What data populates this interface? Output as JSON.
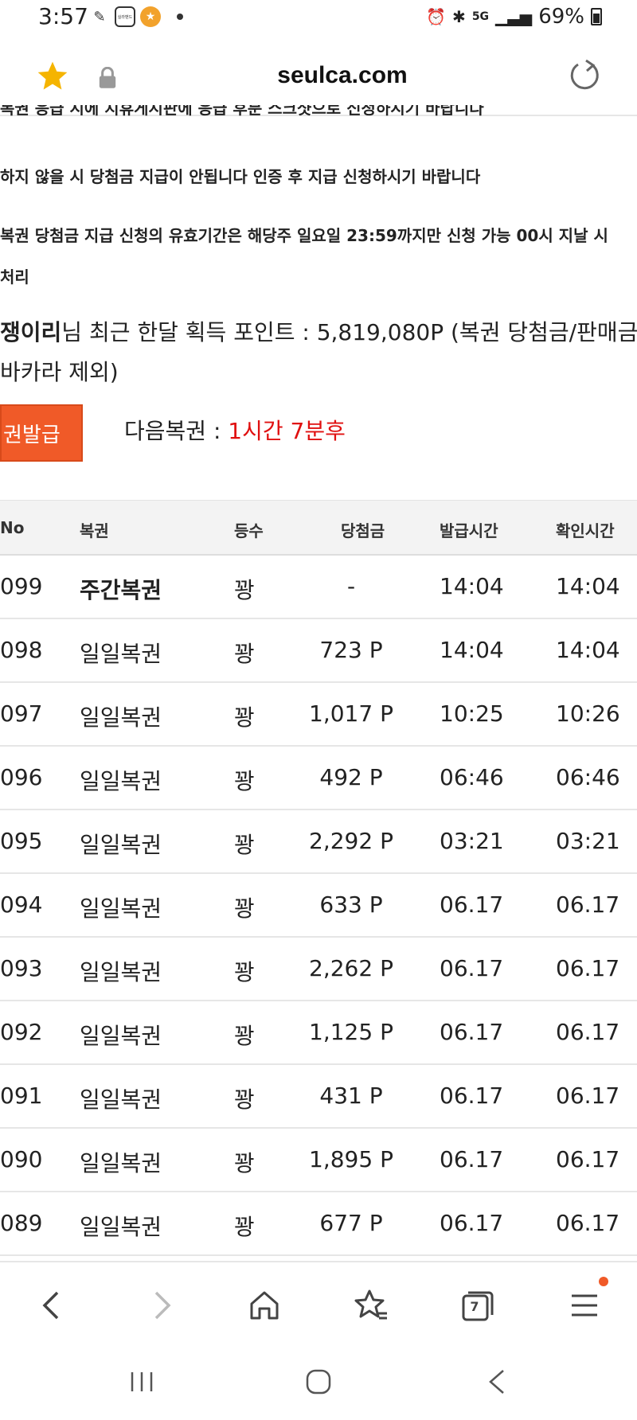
{
  "status": {
    "time": "3:57",
    "signal_label": "5G",
    "battery": "69%",
    "left_icon_box_text": "실라밴드"
  },
  "browser": {
    "url": "seulca.com"
  },
  "notices": {
    "line0": "복권 응급 시에 지휴게시판에 응급 후분 스크샷으로 신청하시기 바랍니다",
    "line1": "하지 않을 시 당첨금 지급이 안됩니다 인증 후 지급 신청하시기 바랍니다",
    "line2": "복권 당첨금 지급 신청의 유효기간은 해당주 일요일 23:59까지만 신청 가능 00시 지날 시",
    "line3": "처리"
  },
  "points": {
    "username": "쟁이리",
    "text": "님 최근 한달 획득 포인트 : 5,819,080P (복권 당첨금/판매금,",
    "text2": " 바카라 제외)"
  },
  "issue_button": "권발급",
  "next_lottery": {
    "label": "다음복권 : ",
    "value": "1시간 7분후"
  },
  "table": {
    "headers": {
      "no": "No",
      "name": "복권",
      "rank": "등수",
      "prize": "당첨금",
      "issued": "발급시간",
      "checked": "확인시간"
    },
    "rows": [
      {
        "no": "099",
        "name": "주간복권",
        "rank": "꽝",
        "prize": "-",
        "issued": "14:04",
        "checked": "14:04"
      },
      {
        "no": "098",
        "name": "일일복권",
        "rank": "꽝",
        "prize": "723 P",
        "issued": "14:04",
        "checked": "14:04"
      },
      {
        "no": "097",
        "name": "일일복권",
        "rank": "꽝",
        "prize": "1,017 P",
        "issued": "10:25",
        "checked": "10:26"
      },
      {
        "no": "096",
        "name": "일일복권",
        "rank": "꽝",
        "prize": "492 P",
        "issued": "06:46",
        "checked": "06:46"
      },
      {
        "no": "095",
        "name": "일일복권",
        "rank": "꽝",
        "prize": "2,292 P",
        "issued": "03:21",
        "checked": "03:21"
      },
      {
        "no": "094",
        "name": "일일복권",
        "rank": "꽝",
        "prize": "633 P",
        "issued": "06.17",
        "checked": "06.17"
      },
      {
        "no": "093",
        "name": "일일복권",
        "rank": "꽝",
        "prize": "2,262 P",
        "issued": "06.17",
        "checked": "06.17"
      },
      {
        "no": "092",
        "name": "일일복권",
        "rank": "꽝",
        "prize": "1,125 P",
        "issued": "06.17",
        "checked": "06.17"
      },
      {
        "no": "091",
        "name": "일일복권",
        "rank": "꽝",
        "prize": "431 P",
        "issued": "06.17",
        "checked": "06.17"
      },
      {
        "no": "090",
        "name": "일일복권",
        "rank": "꽝",
        "prize": "1,895 P",
        "issued": "06.17",
        "checked": "06.17"
      },
      {
        "no": "089",
        "name": "일일복권",
        "rank": "꽝",
        "prize": "677 P",
        "issued": "06.17",
        "checked": "06.17"
      }
    ]
  },
  "bottom_nav": {
    "tab_count": "7"
  },
  "colors": {
    "accent": "#f05a28",
    "next_value": "#e01010",
    "star": "#f5b400"
  }
}
